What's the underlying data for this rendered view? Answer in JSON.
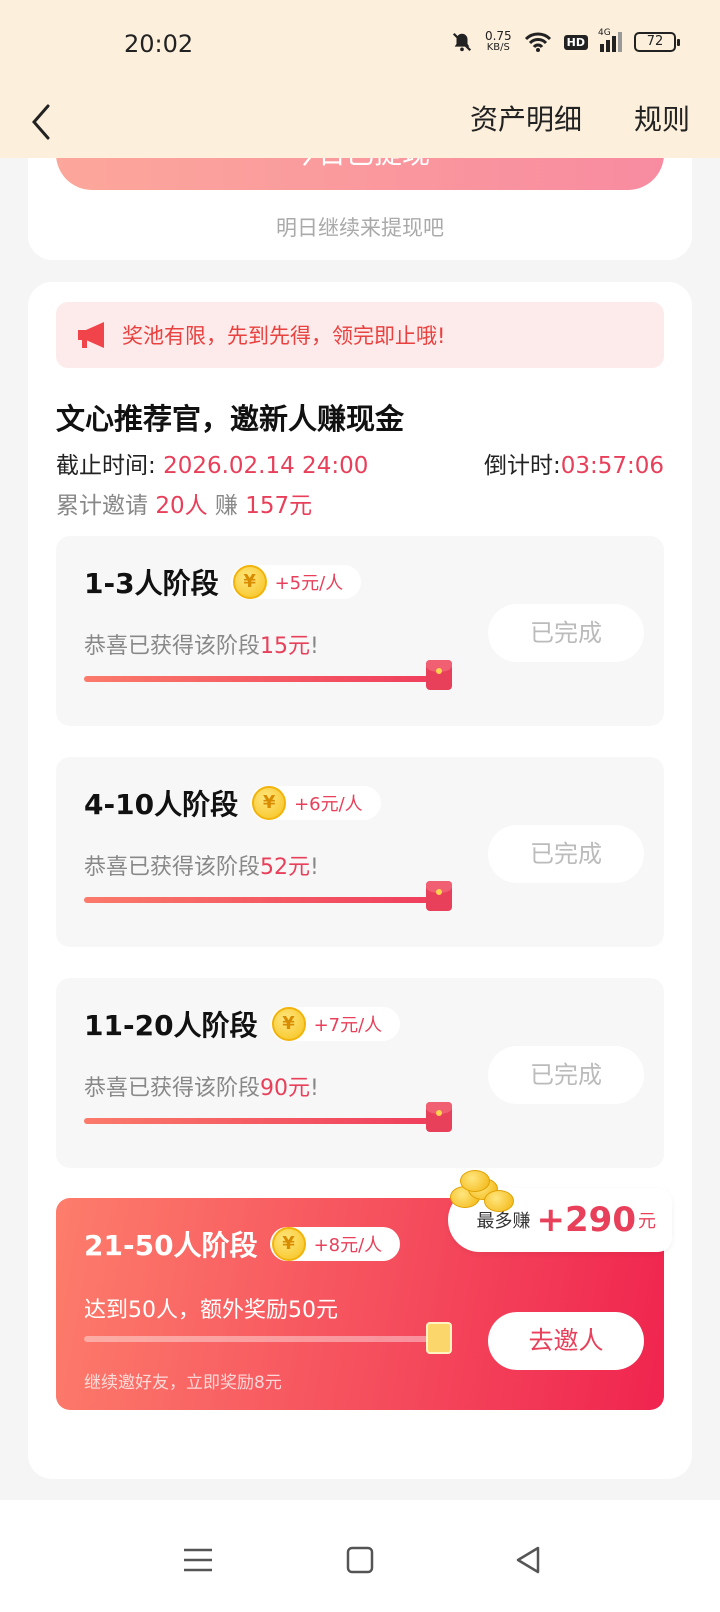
{
  "status_bar": {
    "time": "20:02",
    "net_speed_value": "0.75",
    "net_speed_unit": "KB/S",
    "hd_label": "HD",
    "network_label": "4G",
    "battery": "72"
  },
  "nav": {
    "back_icon": "chevron-left-icon",
    "asset_detail": "资产明细",
    "rules": "规则"
  },
  "top_card": {
    "withdraw_label": "今日已提现",
    "hint": "明日继续来提现吧"
  },
  "notice": {
    "icon": "megaphone-icon",
    "text": "奖池有限，先到先得，领完即止哦!"
  },
  "campaign": {
    "title": "文心推荐官，邀新人赚现金",
    "deadline_label": "截止时间:",
    "deadline_value": "2026.02.14 24:00",
    "countdown_label": "倒计时:",
    "countdown_value": "03:57:06",
    "invited_label": "累计邀请",
    "invited_count": "20人",
    "earned_label": "赚",
    "earned_value": "157元"
  },
  "stages": [
    {
      "title": "1-3人阶段",
      "rate": "+5元/人",
      "desc_prefix": "恭喜已获得该阶段",
      "amount": "15元",
      "desc_suffix": "!",
      "button": "已完成"
    },
    {
      "title": "4-10人阶段",
      "rate": "+6元/人",
      "desc_prefix": "恭喜已获得该阶段",
      "amount": "52元",
      "desc_suffix": "!",
      "button": "已完成"
    },
    {
      "title": "11-20人阶段",
      "rate": "+7元/人",
      "desc_prefix": "恭喜已获得该阶段",
      "amount": "90元",
      "desc_suffix": "!",
      "button": "已完成"
    }
  ],
  "active_stage": {
    "title": "21-50人阶段",
    "rate": "+8元/人",
    "desc": "达到50人，额外奖励50元",
    "hint": "继续邀好友，立即奖励8元",
    "button": "去邀人",
    "max_earn_label": "最多赚",
    "max_earn_value": "+290",
    "max_earn_unit": "元"
  },
  "coin_symbol": "¥",
  "colors": {
    "accent": "#e8405a",
    "status_bg": "#fcefdc"
  }
}
